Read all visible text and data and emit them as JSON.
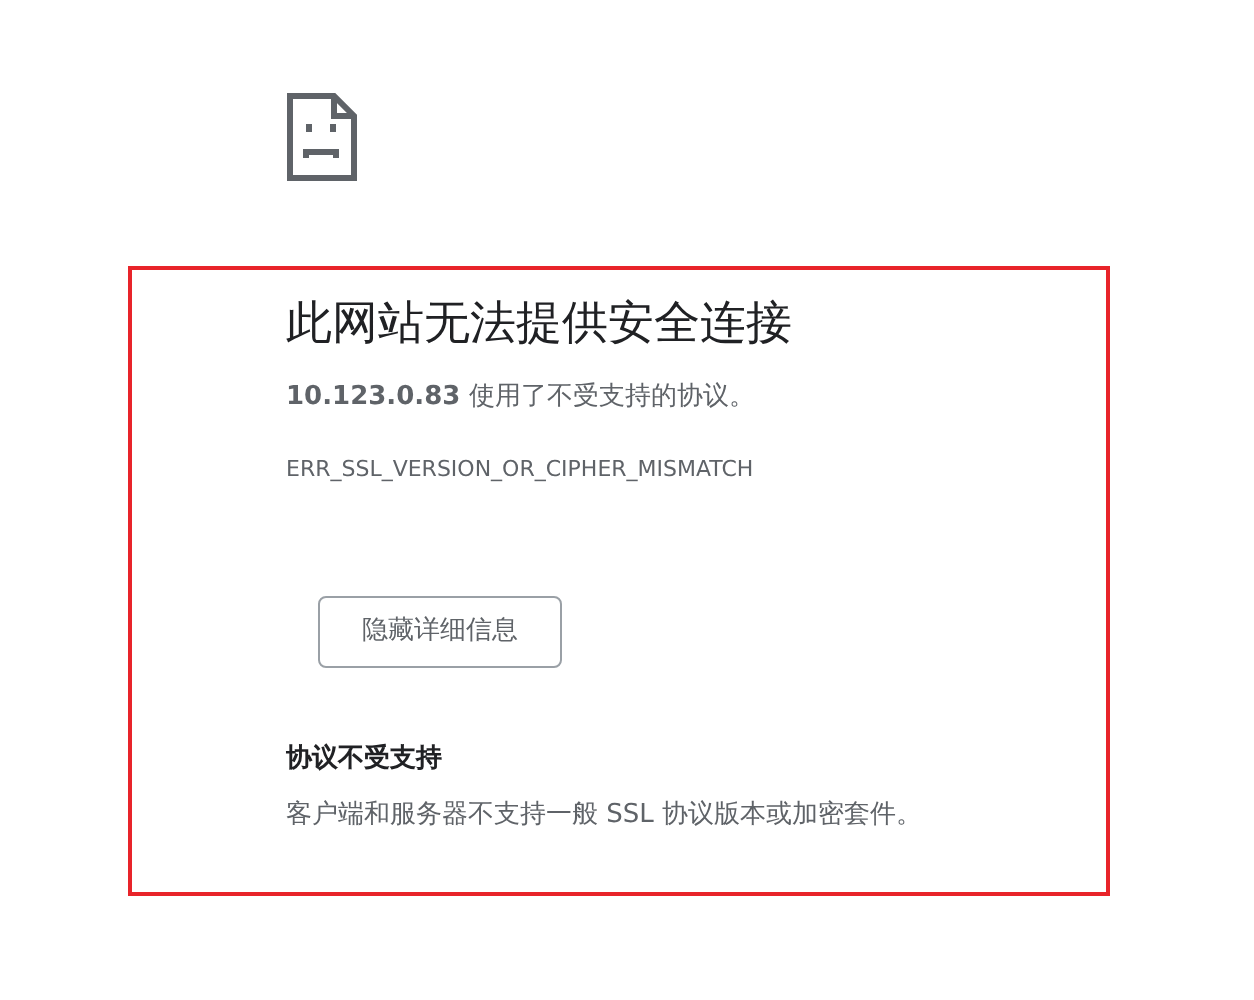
{
  "heading": "此网站无法提供安全连接",
  "summary": "**10.123.0.83** 使用了不受支持的协议。",
  "error_code": "ERR_SSL_VERSION_OR_CIPHER_MISMATCH",
  "details_button": "隐藏详细信息",
  "details": {
    "title": "协议不受支持",
    "text": "客户端和服务器不支持一般 SSL 协议版本或加密套件。"
  }
}
